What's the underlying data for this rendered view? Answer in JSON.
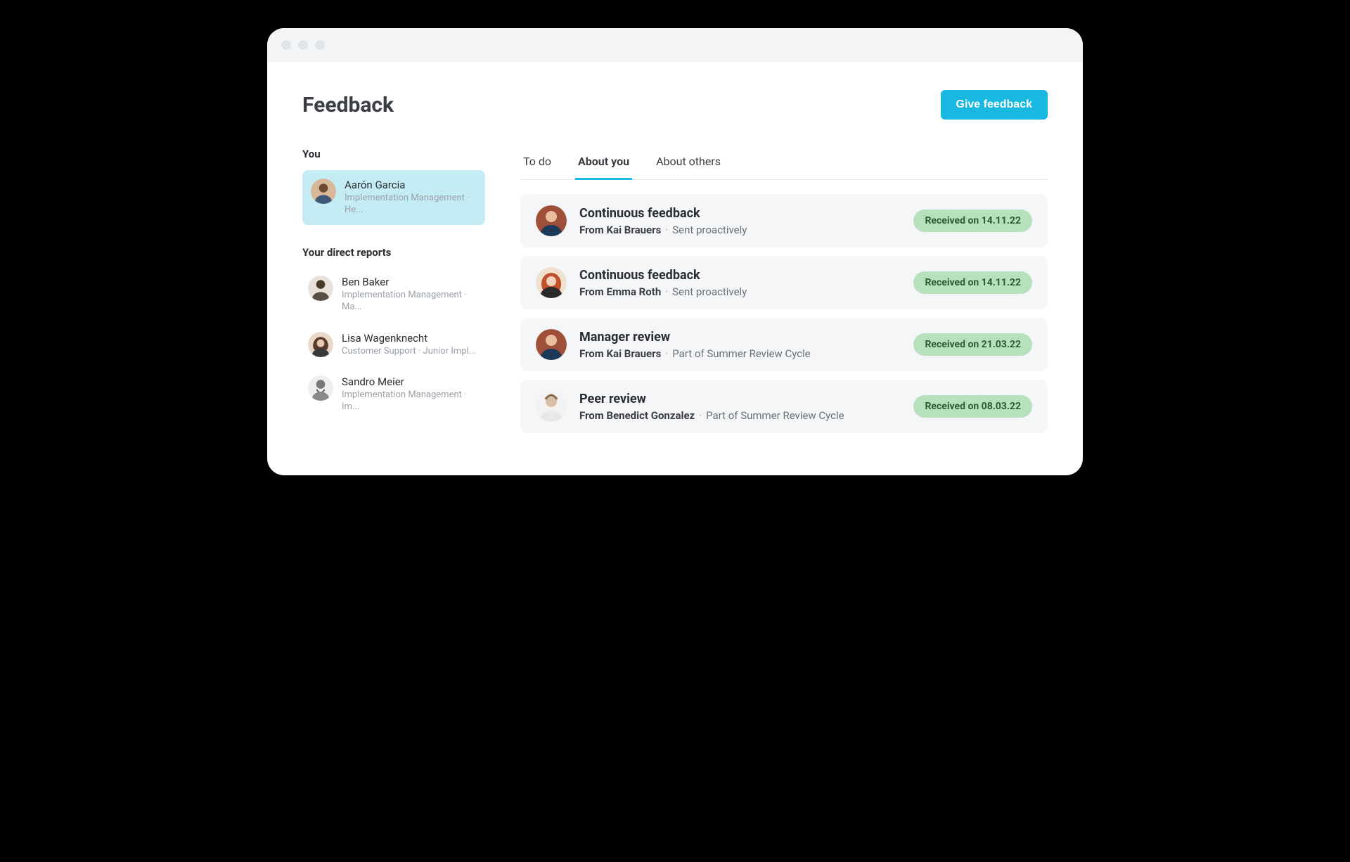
{
  "header": {
    "title": "Feedback",
    "give_feedback_label": "Give feedback"
  },
  "sidebar": {
    "you_label": "You",
    "you": {
      "name": "Aarón Garcia",
      "meta": "Implementation Management · He..."
    },
    "reports_label": "Your direct reports",
    "reports": [
      {
        "name": "Ben Baker",
        "meta": "Implementation Management · Ma..."
      },
      {
        "name": "Lisa Wagenknecht",
        "meta": "Customer Support · Junior Impl..."
      },
      {
        "name": "Sandro Meier",
        "meta": "Implementation Management · Im..."
      }
    ]
  },
  "tabs": {
    "todo": "To do",
    "about_you": "About you",
    "about_others": "About others"
  },
  "feedback": [
    {
      "title": "Continuous feedback",
      "from_prefix": "From ",
      "from_name": "Kai Brauers",
      "context": "Sent proactively",
      "badge": "Received on 14.11.22"
    },
    {
      "title": "Continuous feedback",
      "from_prefix": "From ",
      "from_name": "Emma Roth",
      "context": "Sent proactively",
      "badge": "Received on 14.11.22"
    },
    {
      "title": "Manager review",
      "from_prefix": "From ",
      "from_name": "Kai Brauers",
      "context": "Part of Summer Review Cycle",
      "badge": "Received on 21.03.22"
    },
    {
      "title": "Peer review",
      "from_prefix": "From ",
      "from_name": "Benedict Gonzalez",
      "context": "Part of Summer Review Cycle",
      "badge": "Received on 08.03.22"
    }
  ]
}
